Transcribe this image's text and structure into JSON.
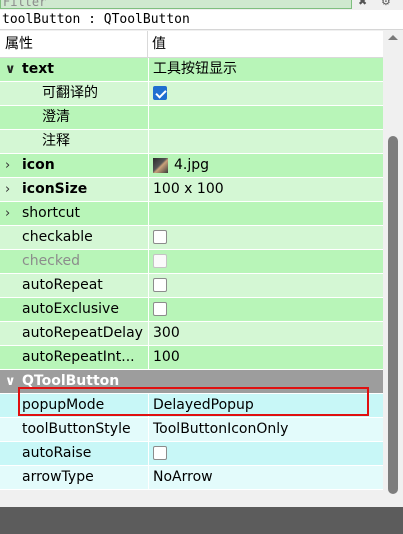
{
  "filter": {
    "placeholder": "Filter",
    "clear_icon": "clear-icon",
    "settings_icon": "gear-icon"
  },
  "object_title": "toolButton : QToolButton",
  "table": {
    "header_property": "属性",
    "header_value": "值",
    "rows": [
      {
        "name": "text",
        "value": "工具按钮显示",
        "bg": "green",
        "arrow": "down",
        "bold": true,
        "indent": 0
      },
      {
        "name": "可翻译的",
        "check": "checked",
        "bg": "green-light",
        "indent": 1
      },
      {
        "name": "澄清",
        "value": "",
        "bg": "green",
        "indent": 1
      },
      {
        "name": "注释",
        "value": "",
        "bg": "green-light",
        "indent": 1
      },
      {
        "name": "icon",
        "value": "4.jpg",
        "bg": "green",
        "arrow": "right",
        "bold": true,
        "icon": true,
        "indent": 0
      },
      {
        "name": "iconSize",
        "value": "100 x 100",
        "bg": "green-light",
        "arrow": "right",
        "bold": true,
        "indent": 0
      },
      {
        "name": "shortcut",
        "value": "",
        "bg": "green",
        "arrow": "right",
        "indent": 0
      },
      {
        "name": "checkable",
        "check": "unchecked",
        "bg": "green-light",
        "indent": 0
      },
      {
        "name": "checked",
        "check": "dim",
        "bg": "green",
        "disabled": true,
        "indent": 0
      },
      {
        "name": "autoRepeat",
        "check": "unchecked",
        "bg": "green-light",
        "indent": 0
      },
      {
        "name": "autoExclusive",
        "check": "unchecked",
        "bg": "green",
        "indent": 0
      },
      {
        "name": "autoRepeatDelay",
        "value": "300",
        "bg": "green-light",
        "indent": 0
      },
      {
        "name": "autoRepeatInt...",
        "value": "100",
        "bg": "green",
        "indent": 0
      },
      {
        "name": "QToolButton",
        "bg": "section",
        "arrow": "down",
        "section": true,
        "indent": 0
      },
      {
        "name": "popupMode",
        "value": "DelayedPopup",
        "bg": "cyan",
        "indent": 0
      },
      {
        "name": "toolButtonStyle",
        "value": "ToolButtonIconOnly",
        "bg": "cyan-light",
        "indent": 0
      },
      {
        "name": "autoRaise",
        "check": "unchecked",
        "bg": "cyan",
        "indent": 0
      },
      {
        "name": "arrowType",
        "value": "NoArrow",
        "bg": "cyan-light",
        "indent": 0
      }
    ]
  },
  "colors": {
    "green": "#b8f5b8",
    "green_light": "#d4f7d4",
    "cyan": "#c8f7f7",
    "cyan_light": "#e3fbfb",
    "section": "#9d9d9d",
    "highlight": "#e01010",
    "checkbox_checked": "#1f6fd0"
  }
}
